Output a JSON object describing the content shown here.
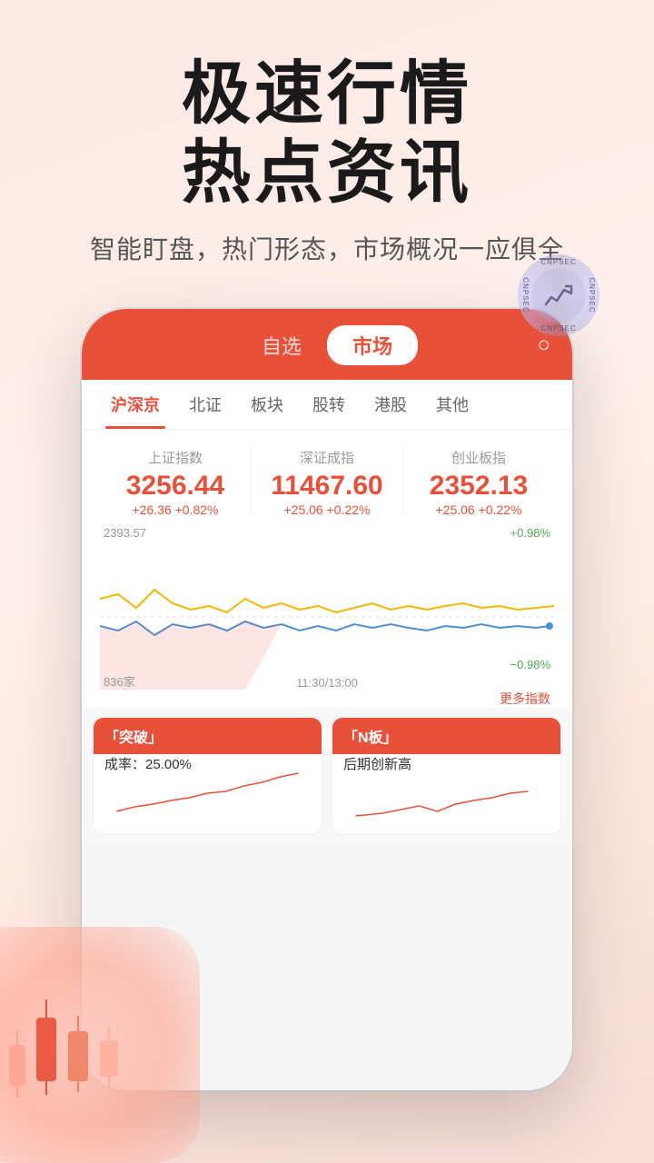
{
  "hero": {
    "title_line1": "极速行情",
    "title_line2": "热点资讯",
    "subtitle": "智能盯盘，热门形态，市场概况一应俱全"
  },
  "app": {
    "nav_items": [
      "自选",
      "市场"
    ],
    "active_nav": "市场",
    "tabs": [
      "沪深京",
      "北证",
      "板块",
      "股转",
      "港股",
      "其他"
    ],
    "active_tab": "沪深京"
  },
  "indices": [
    {
      "label": "上证指数",
      "value": "3256.44",
      "change": "+26.36 +0.82%"
    },
    {
      "label": "深证成指",
      "value": "11467.60",
      "change": "+25.06 +0.22%"
    },
    {
      "label": "创业板指",
      "value": "2352.13",
      "change": "+25.06 +0.22%"
    }
  ],
  "chart": {
    "top_left": "2393.57",
    "top_right": "+0.98%",
    "bottom_right": "−0.98%",
    "time_label": "11:30/13:00",
    "count_label": "836家",
    "more_label": "更多指数"
  },
  "cards": [
    {
      "id": "card1",
      "title": "「突破」",
      "content_text": "成率：25.00%",
      "has_sparkline": true
    },
    {
      "id": "card2",
      "title": "「N板」",
      "content_text": "后期创新高",
      "has_sparkline": true
    }
  ],
  "watermark": {
    "text": "CNPSEC"
  }
}
